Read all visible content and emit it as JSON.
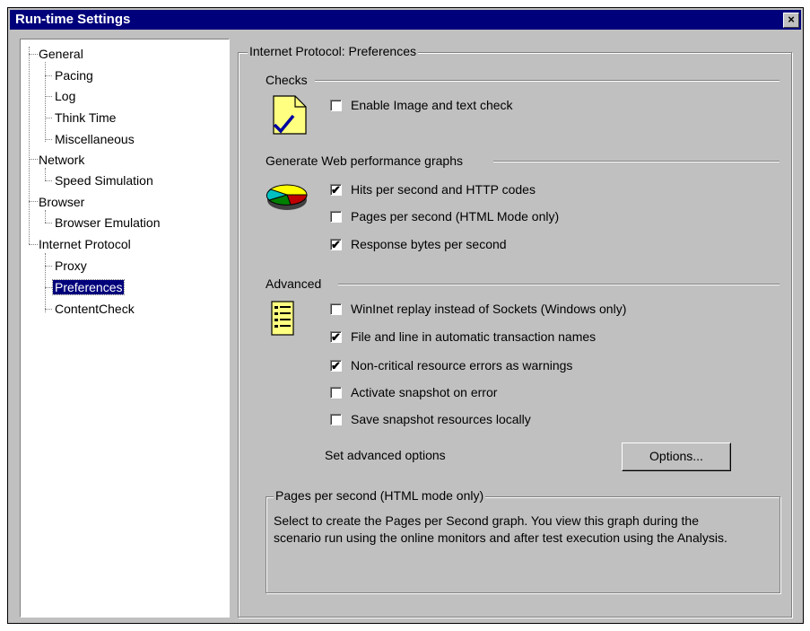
{
  "window": {
    "title": "Run-time Settings",
    "close_glyph": "×"
  },
  "tree": {
    "items": [
      {
        "label": "General"
      },
      {
        "label": "Pacing"
      },
      {
        "label": "Log"
      },
      {
        "label": "Think Time"
      },
      {
        "label": "Miscellaneous"
      },
      {
        "label": "Network"
      },
      {
        "label": "Speed Simulation"
      },
      {
        "label": "Browser"
      },
      {
        "label": "Browser Emulation"
      },
      {
        "label": "Internet Protocol"
      },
      {
        "label": "Proxy"
      },
      {
        "label": "Preferences"
      },
      {
        "label": "ContentCheck"
      }
    ],
    "selected": "Preferences"
  },
  "panel": {
    "group_title": "Internet Protocol: Preferences",
    "checks": {
      "title": "Checks",
      "icon": "checked-document-icon",
      "options": [
        {
          "label": "Enable Image and text check",
          "checked": false,
          "check_glyph": ""
        }
      ]
    },
    "graphs": {
      "title": "Generate Web performance graphs",
      "icon": "pie-chart-icon",
      "options": [
        {
          "label": "Hits per second and HTTP codes",
          "checked": true,
          "check_glyph": "✔"
        },
        {
          "label": "Pages per second (HTML Mode only)",
          "checked": false,
          "check_glyph": ""
        },
        {
          "label": "Response bytes per second",
          "checked": true,
          "check_glyph": "✔"
        }
      ]
    },
    "advanced": {
      "title": "Advanced",
      "icon": "notepad-list-icon",
      "options": [
        {
          "label": "WinInet replay instead of Sockets (Windows only)",
          "checked": false,
          "check_glyph": ""
        },
        {
          "label": "File and line in automatic transaction names",
          "checked": true,
          "check_glyph": "✔"
        },
        {
          "label": "Non-critical resource errors as warnings",
          "checked": true,
          "check_glyph": "✔"
        },
        {
          "label": "Activate snapshot on error",
          "checked": false,
          "check_glyph": ""
        },
        {
          "label": "Save snapshot resources locally",
          "checked": false,
          "check_glyph": ""
        }
      ],
      "set_options_label": "Set advanced options",
      "options_button": "Options..."
    },
    "description": {
      "title": "Pages per second (HTML mode only)",
      "line1": "Select to create the Pages per Second graph. You view this graph during the",
      "line2": "scenario run using the online monitors and after test execution using the Analysis."
    }
  }
}
